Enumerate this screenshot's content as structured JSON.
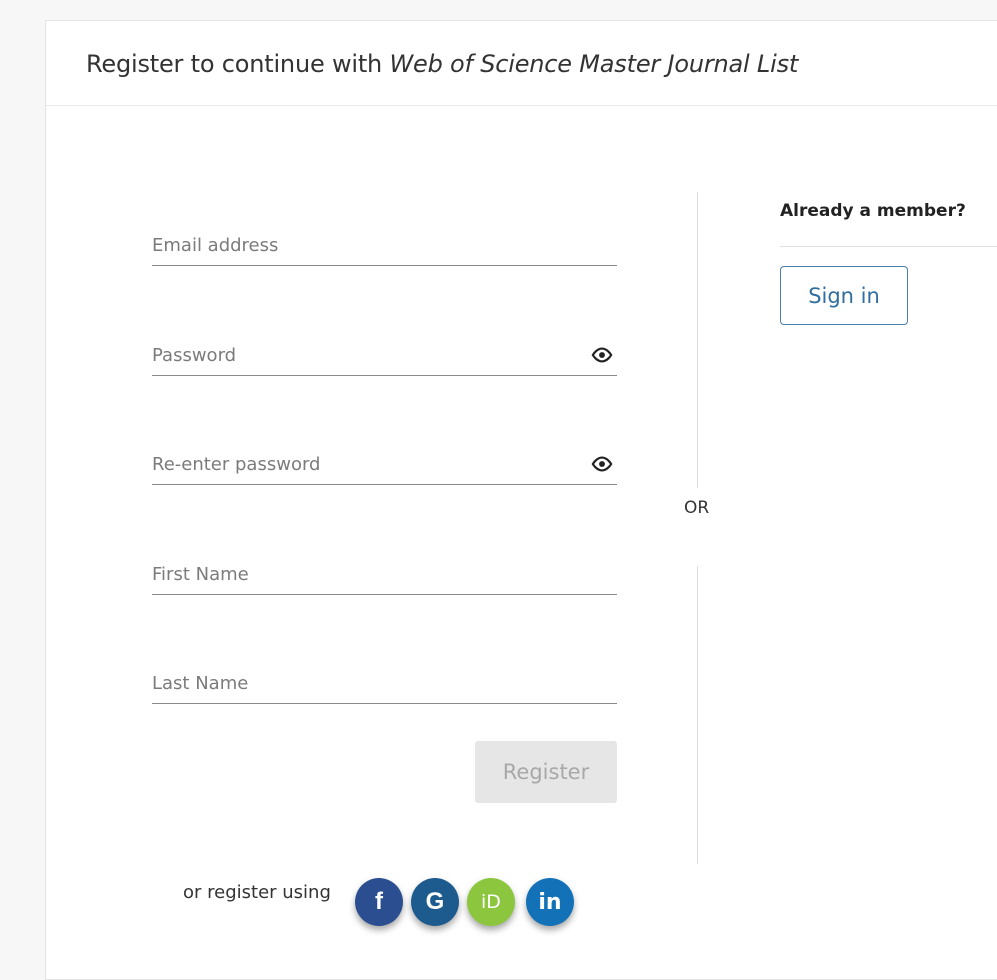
{
  "header": {
    "title_prefix": "Register to continue with ",
    "title_product": "Web of Science Master Journal List"
  },
  "form": {
    "email": {
      "placeholder": "Email address",
      "value": ""
    },
    "password": {
      "placeholder": "Password",
      "value": ""
    },
    "confirm_password": {
      "placeholder": "Re-enter password",
      "value": ""
    },
    "first_name": {
      "placeholder": "First Name",
      "value": ""
    },
    "last_name": {
      "placeholder": "Last Name",
      "value": ""
    },
    "register_label": "Register",
    "social_label": "or register using",
    "social_icons": [
      "facebook-icon",
      "google-icon",
      "orcid-icon",
      "linkedin-icon"
    ],
    "social_glyphs": {
      "facebook": "f",
      "google": "G",
      "orcid": "iD",
      "linkedin": "in"
    }
  },
  "divider": {
    "label": "OR"
  },
  "member": {
    "heading": "Already a member?",
    "signin_label": "Sign in"
  },
  "colors": {
    "facebook": "#2a4e8f",
    "google": "#1d5b8f",
    "orcid": "#8cc63f",
    "linkedin": "#1372b7",
    "signin_border": "#4a7fa8",
    "register_disabled_bg": "#e6e6e6"
  }
}
